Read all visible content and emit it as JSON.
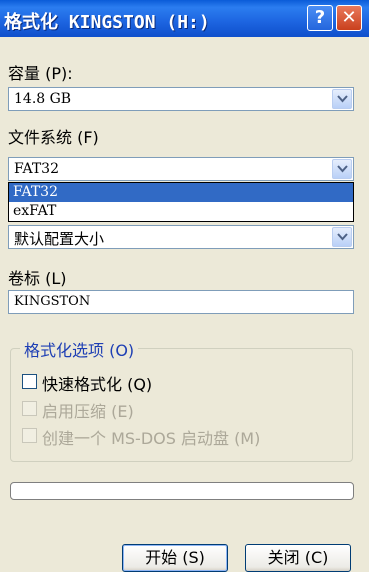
{
  "window": {
    "title": "格式化 KINGSTON (H:)",
    "help_glyph": "?",
    "close_glyph": "✕"
  },
  "capacity": {
    "label": "容量 (P):",
    "value": "14.8 GB"
  },
  "filesystem": {
    "label": "文件系统 (F)",
    "value": "FAT32",
    "options": [
      "FAT32",
      "exFAT"
    ],
    "highlighted_index": 0
  },
  "allocation": {
    "value": "默认配置大小"
  },
  "volume_label": {
    "label": "卷标 (L)",
    "value": "KINGSTON"
  },
  "format_options": {
    "title": "格式化选项 (O)",
    "quick_format": {
      "label": "快速格式化 (Q)",
      "checked": false,
      "enabled": true
    },
    "compression": {
      "label": "启用压缩 (E)",
      "checked": false,
      "enabled": false
    },
    "msdos_disk": {
      "label": "创建一个 MS-DOS 启动盘 (M)",
      "checked": false,
      "enabled": false
    }
  },
  "progress": {
    "value": 0
  },
  "buttons": {
    "start": "开始 (S)",
    "close": "关闭 (C)"
  },
  "colors": {
    "titlebar": "#0a5bd8",
    "selection": "#316ac5",
    "group_title": "#1e3fb4",
    "disabled_text": "#aca899"
  }
}
